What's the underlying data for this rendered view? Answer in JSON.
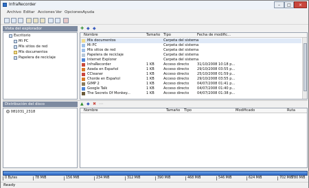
{
  "window": {
    "title": "InfraRecorder"
  },
  "menu": [
    "Archivo",
    "Editar",
    "Acciones",
    "Ver",
    "Opciones",
    "Ayuda"
  ],
  "explorer": {
    "header": "Vista del explorador"
  },
  "tree": [
    {
      "label": "Escritorio"
    },
    {
      "label": "Mi PC"
    },
    {
      "label": "Mis sitios de red"
    },
    {
      "label": "Mis documentos"
    },
    {
      "label": "Papelera de reciclaje"
    }
  ],
  "columns": {
    "name": "Nombre",
    "size": "Tamaño",
    "type": "Tipo",
    "modified": "Fecha de modific..."
  },
  "files": [
    {
      "name": "Mis documentos",
      "size": "",
      "type": "Carpeta del sistema",
      "modified": ""
    },
    {
      "name": "Mi PC",
      "size": "",
      "type": "Carpeta del sistema",
      "modified": ""
    },
    {
      "name": "Mis sitios de red",
      "size": "",
      "type": "Carpeta del sistema",
      "modified": ""
    },
    {
      "name": "Papelera de reciclaje",
      "size": "",
      "type": "Carpeta del sistema",
      "modified": ""
    },
    {
      "name": "Internet Explorer",
      "size": "",
      "type": "Carpeta del sistema",
      "modified": ""
    },
    {
      "name": "InfraRecorder",
      "size": "1 KB",
      "type": "Acceso directo",
      "modified": "31/10/2008 10:18 p..."
    },
    {
      "name": "Azada en Español",
      "size": "1 KB",
      "type": "Acceso directo",
      "modified": "29/10/2008 03:55 p..."
    },
    {
      "name": "CCleaner",
      "size": "1 KB",
      "type": "Acceso directo",
      "modified": "25/10/2008 01:59 p..."
    },
    {
      "name": "Chorde en Español",
      "size": "1 KB",
      "type": "Acceso directo",
      "modified": "29/10/2008 03:55 p..."
    },
    {
      "name": "GIMP 2",
      "size": "1 KB",
      "type": "Acceso directo",
      "modified": "04/07/2008 01:41 p..."
    },
    {
      "name": "Google Talk",
      "size": "1 KB",
      "type": "Acceso directo",
      "modified": "04/07/2008 01:40 p..."
    },
    {
      "name": "The Secrets Of Monkey...",
      "size": "1 KB",
      "type": "Acceso directo",
      "modified": "04/07/2008 01:38 p..."
    }
  ],
  "disk": {
    "header": "Distribución del disco",
    "item": "081031_2318"
  },
  "bottom_columns": {
    "name": "Nombre",
    "size": "Tamaño",
    "type": "Tipo",
    "modified": "Modificado",
    "path": "Ruta"
  },
  "scale": [
    "0 Bytes",
    "78 MiB",
    "156 MiB",
    "234 MiB",
    "312 MiB",
    "390 MiB",
    "468 MiB",
    "546 MiB",
    "624 MiB",
    "702 MiB",
    "780 MiB"
  ],
  "status": "Ready"
}
